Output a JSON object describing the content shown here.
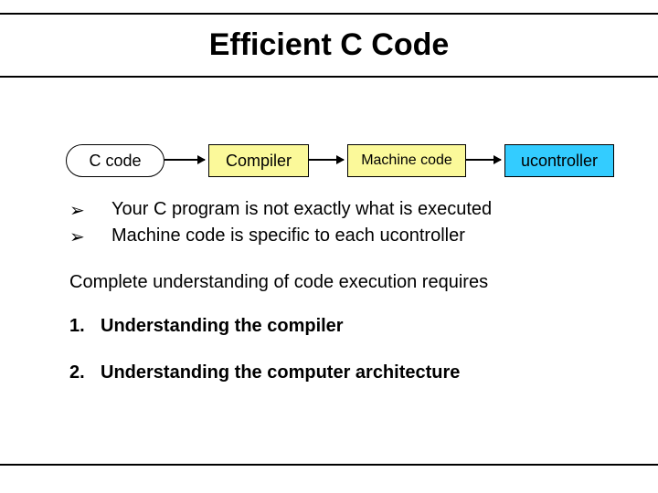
{
  "title": "Efficient C Code",
  "diagram": {
    "nodes": [
      {
        "label": "C code"
      },
      {
        "label": "Compiler"
      },
      {
        "label": "Machine code"
      },
      {
        "label": "ucontroller"
      }
    ]
  },
  "bullets": {
    "symbol": "➢",
    "items": [
      "Your C program is not exactly what is executed",
      "Machine code is specific to each ucontroller"
    ]
  },
  "subtitle": "Complete understanding of code execution requires",
  "numbered": [
    {
      "n": "1.",
      "text": "Understanding the compiler"
    },
    {
      "n": "2.",
      "text": "Understanding the computer architecture"
    }
  ]
}
